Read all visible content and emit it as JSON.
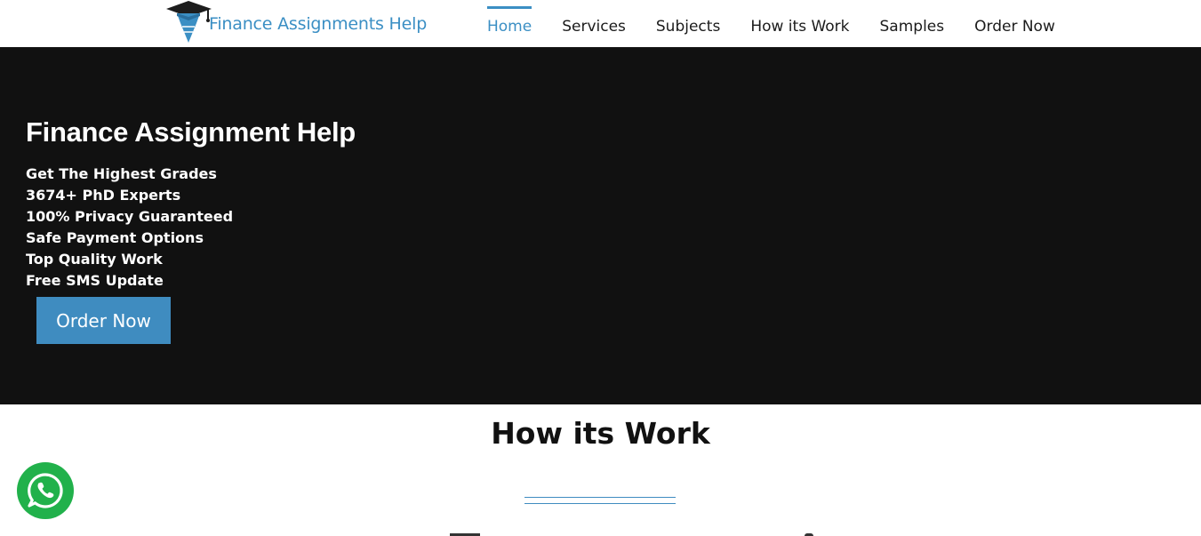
{
  "header": {
    "logo_text": "Finance Assignments Help",
    "nav": [
      {
        "label": "Home",
        "active": true
      },
      {
        "label": "Services"
      },
      {
        "label": "Subjects"
      },
      {
        "label": "How its Work"
      },
      {
        "label": "Samples"
      },
      {
        "label": "Order Now"
      }
    ]
  },
  "hero": {
    "title": "Finance Assignment Help",
    "features": [
      "Get The Highest Grades",
      "3674+ PhD Experts",
      "100% Privacy Guaranteed",
      "Safe Payment Options",
      "Top Quality Work",
      "Free SMS Update"
    ],
    "cta_label": "Order Now"
  },
  "how_it_works": {
    "title": "How its Work"
  },
  "colors": {
    "accent": "#3f8cc0",
    "hero_bg": "#111111",
    "whatsapp": "#21b14b"
  },
  "icons": {
    "logo": "graduation-cap-shield-icon",
    "chat": "whatsapp-icon"
  }
}
